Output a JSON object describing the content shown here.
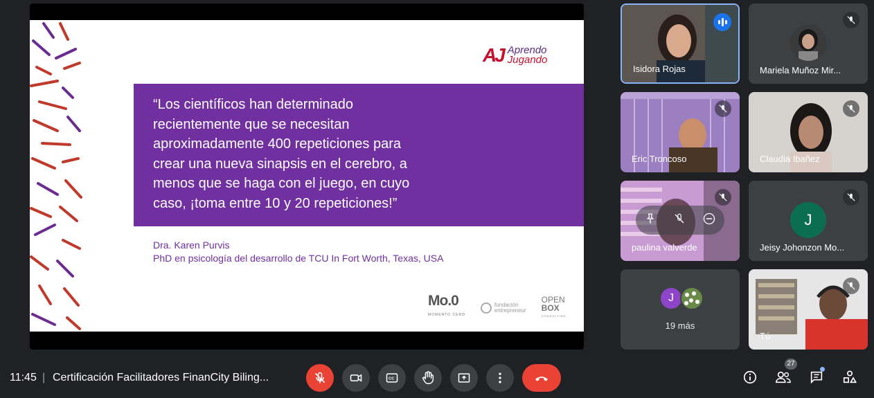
{
  "presentation": {
    "brand_line1": "Aprendo",
    "brand_line2": "Jugando",
    "brand_mark": "AJ",
    "quote": "“Los científicos han determinado recientemente que se necesitan aproximadamente 400 repeticiones para crear una nueva sinapsis en el cerebro, a menos que se haga con el juego, en cuyo caso, ¡toma entre 10 y 20 repeticiones!”",
    "author_name": "Dra. Karen Purvis",
    "author_title": "PhD en psicología del desarrollo de TCU In Fort Worth, Texas, USA",
    "logo1": "Mo.0",
    "logo1_sub": "MOMENTO CERO",
    "logo2_line1": "fundación",
    "logo2_line2": "entrepreneur",
    "logo3_line1": "OPEN",
    "logo3_line2": "BOX",
    "logo3_sub": "CONSULTING",
    "accent_color": "#7030a0"
  },
  "participants": [
    {
      "name": "Isidora Rojas",
      "speaking": true
    },
    {
      "name": "Mariela Muñoz Mir...",
      "muted": true
    },
    {
      "name": "Eric Troncoso",
      "muted": true
    },
    {
      "name": "Claudia Ibañez",
      "muted": true
    },
    {
      "name": "paulina valverde",
      "muted": true
    },
    {
      "name": "Jeisy Johonzon Mo...",
      "muted": true,
      "avatar_letter": "J",
      "avatar_color": "#0b6e4f"
    },
    {
      "name": "Tú",
      "muted": true
    }
  ],
  "more_tile": {
    "label": "19 más",
    "avatar_letter": "J",
    "avatar_color": "#8e44c8"
  },
  "bottom_bar": {
    "time": "11:45",
    "separator": "|",
    "meeting_title": "Certificación Facilitadores FinanCity Biling...",
    "participant_count": "27",
    "icons": [
      "mic-off-icon",
      "camera-icon",
      "captions-icon",
      "raise-hand-icon",
      "present-icon",
      "more-icon",
      "hangup-icon",
      "info-icon",
      "people-icon",
      "chat-icon",
      "activities-icon"
    ]
  }
}
